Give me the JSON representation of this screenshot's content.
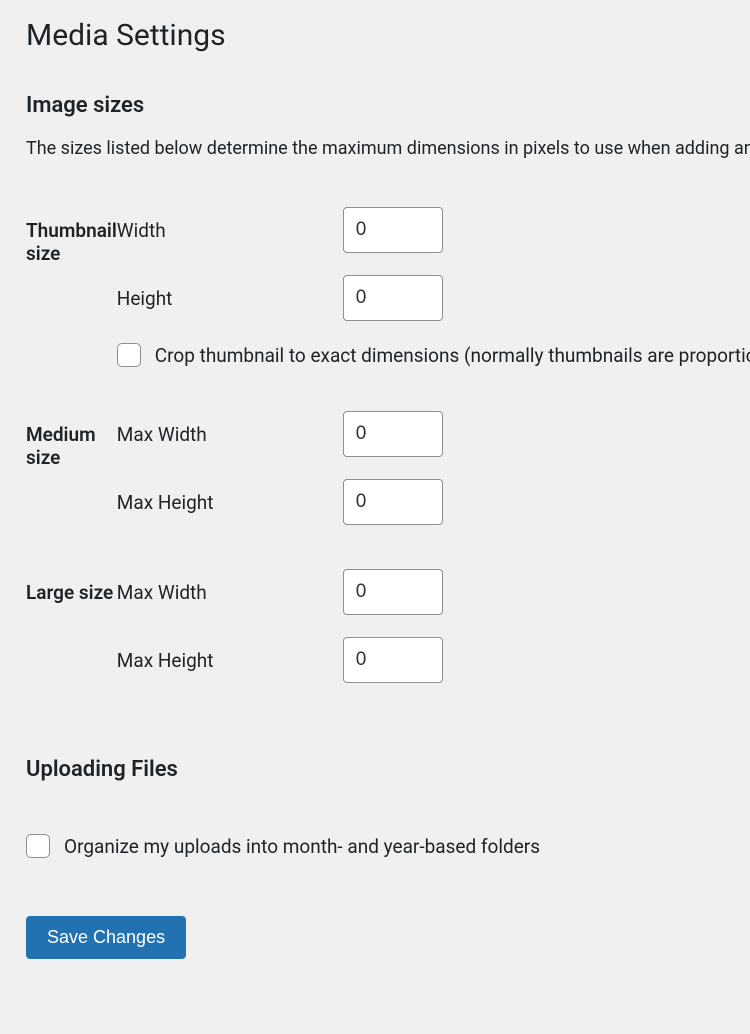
{
  "page_title": "Media Settings",
  "image_sizes": {
    "heading": "Image sizes",
    "description": "The sizes listed below determine the maximum dimensions in pixels to use when adding an image to the Media Library.",
    "thumbnail": {
      "group_label": "Thumbnail size",
      "width_label": "Width",
      "width_value": "0",
      "height_label": "Height",
      "height_value": "0",
      "crop_label": "Crop thumbnail to exact dimensions (normally thumbnails are proportional)"
    },
    "medium": {
      "group_label": "Medium size",
      "max_width_label": "Max Width",
      "max_width_value": "0",
      "max_height_label": "Max Height",
      "max_height_value": "0"
    },
    "large": {
      "group_label": "Large size",
      "max_width_label": "Max Width",
      "max_width_value": "0",
      "max_height_label": "Max Height",
      "max_height_value": "0"
    }
  },
  "uploading": {
    "heading": "Uploading Files",
    "organize_label": "Organize my uploads into month- and year-based folders"
  },
  "submit": {
    "save_label": "Save Changes"
  }
}
